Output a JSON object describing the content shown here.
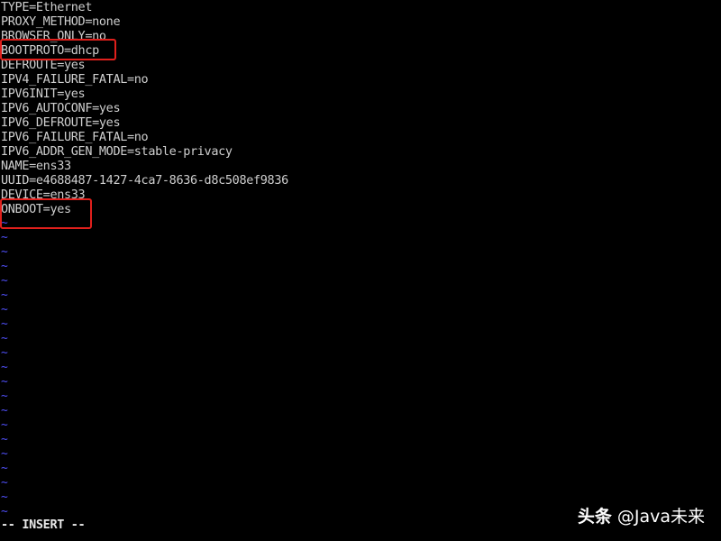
{
  "editor": {
    "lines": [
      "TYPE=Ethernet",
      "PROXY_METHOD=none",
      "BROWSER_ONLY=no",
      "BOOTPROTO=dhcp",
      "DEFROUTE=yes",
      "IPV4_FAILURE_FATAL=no",
      "IPV6INIT=yes",
      "IPV6_AUTOCONF=yes",
      "IPV6_DEFROUTE=yes",
      "IPV6_FAILURE_FATAL=no",
      "IPV6_ADDR_GEN_MODE=stable-privacy",
      "NAME=ens33",
      "UUID=e4688487-1427-4ca7-8636-d8c508ef9836",
      "DEVICE=ens33",
      "ONBOOT=yes"
    ],
    "empty_line_marker": "~",
    "empty_line_count": 21,
    "mode": "-- INSERT --"
  },
  "highlights": [
    "BOOTPROTO=dhcp",
    "ONBOOT=yes"
  ],
  "watermark": {
    "brand": "头条",
    "handle": "@Java未来"
  },
  "colors": {
    "background": "#000000",
    "text": "#cfcfcf",
    "tilde": "#4e4ef5",
    "highlight_border": "#e0201c"
  }
}
